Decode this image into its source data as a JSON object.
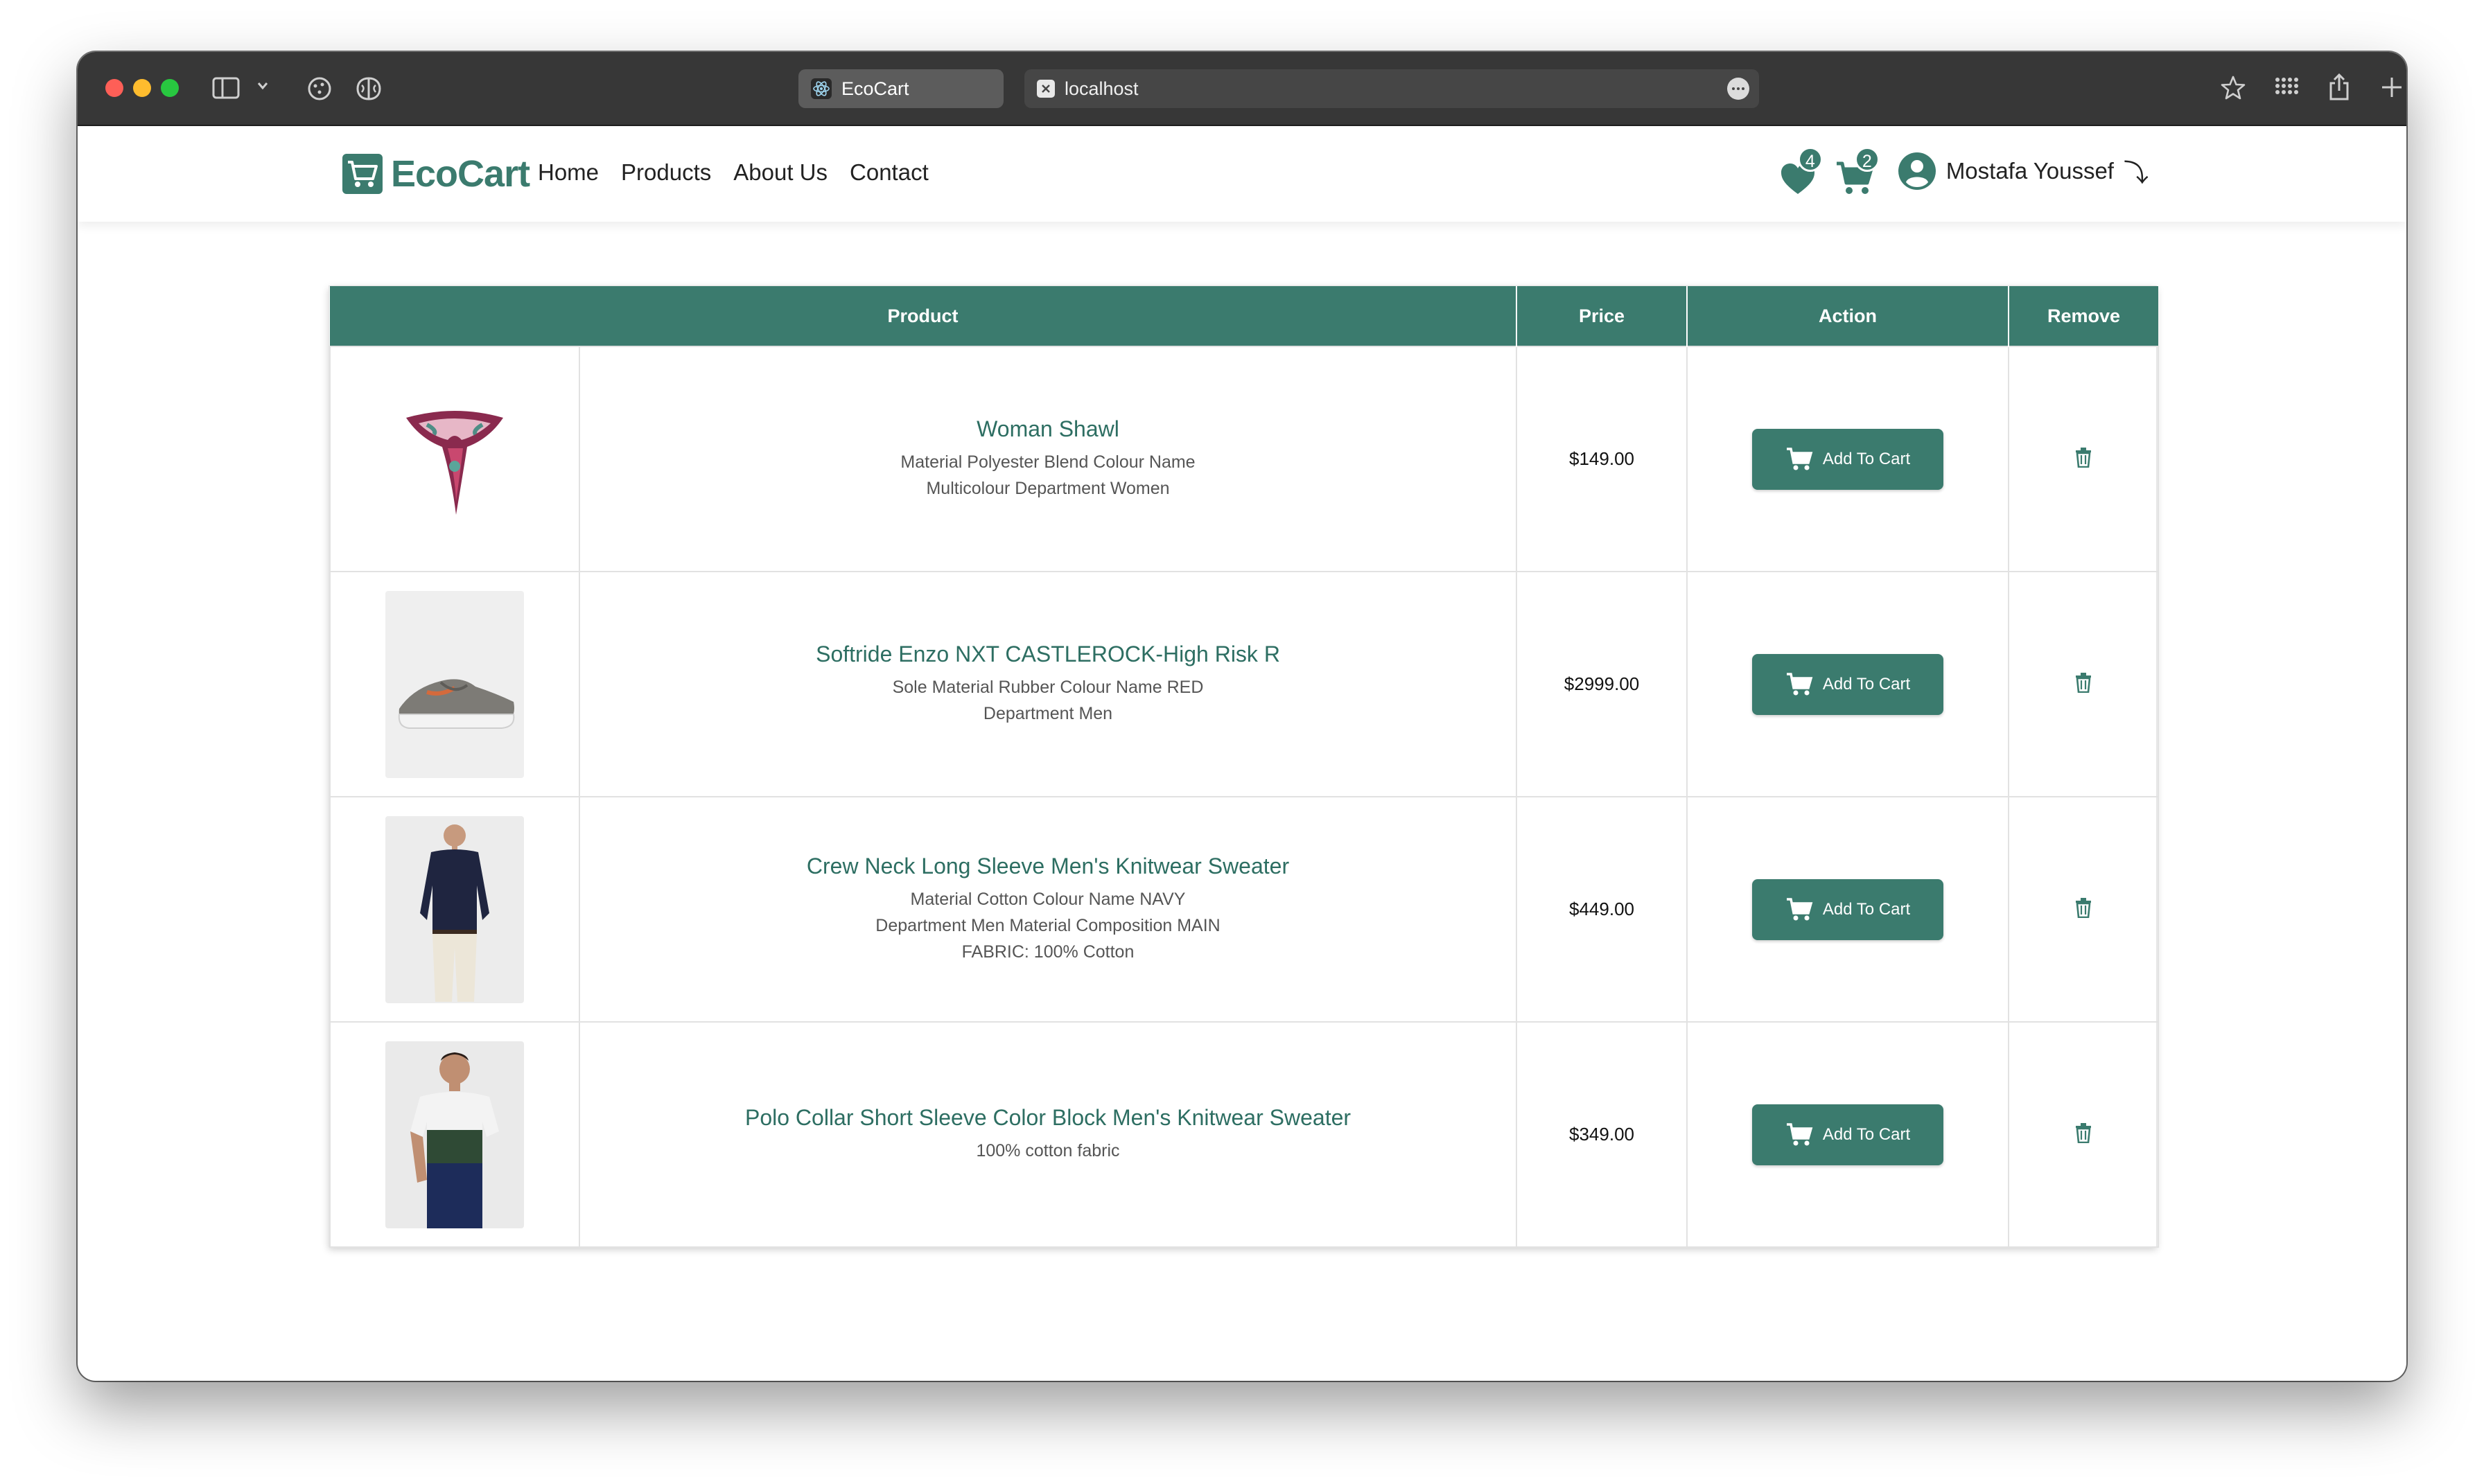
{
  "browser": {
    "tab_title": "EcoCart",
    "address": "localhost"
  },
  "navbar": {
    "logo_text": "EcoCart",
    "links": [
      "Home",
      "Products",
      "About Us",
      "Contact"
    ],
    "wishlist_count": "4",
    "cart_count": "2",
    "user_name": "Mostafa Youssef",
    "logout_glyph": "⤵"
  },
  "table": {
    "headers": {
      "product": "Product",
      "price": "Price",
      "action": "Action",
      "remove": "Remove"
    },
    "button_label": "Add To Cart",
    "rows": [
      {
        "title": "Woman Shawl",
        "description": "Material Polyester Blend Colour Name Multicolour Department Women",
        "price": "$149.00",
        "image": "scarf"
      },
      {
        "title": "Softride Enzo NXT CASTLEROCK-High Risk R",
        "description": "Sole Material Rubber Colour Name RED Department Men",
        "price": "$2999.00",
        "image": "sneaker"
      },
      {
        "title": "Crew Neck Long Sleeve Men's Knitwear Sweater",
        "description": "Material Cotton Colour Name NAVY Department Men Material Composition MAIN FABRIC: 100% Cotton",
        "price": "$449.00",
        "image": "navy-sweater-man"
      },
      {
        "title": "Polo Collar Short Sleeve Color Block Men's Knitwear Sweater",
        "description": "100% cotton fabric",
        "price": "$349.00",
        "image": "polo-man"
      }
    ]
  },
  "colors": {
    "brand": "#3b7b6e",
    "titlebar": "#373737"
  }
}
